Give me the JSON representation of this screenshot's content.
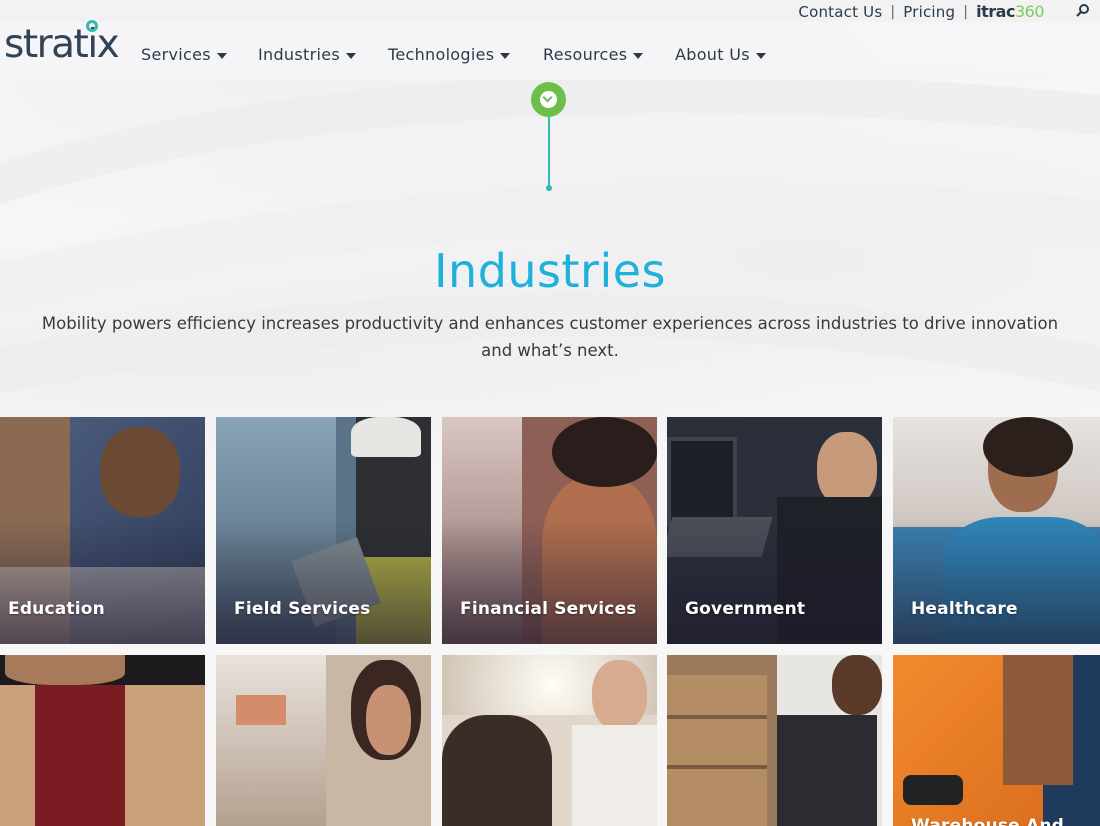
{
  "utility": {
    "contact": "Contact Us",
    "pricing": "Pricing",
    "sep": "|",
    "itrac_prefix": "itrac",
    "itrac_suffix": "360"
  },
  "brand": {
    "logo": "stratix"
  },
  "nav": {
    "items": [
      {
        "label": "Services"
      },
      {
        "label": "Industries"
      },
      {
        "label": "Technologies"
      },
      {
        "label": "Resources"
      },
      {
        "label": "About Us"
      }
    ]
  },
  "hero": {
    "title": "Industries",
    "subtitle": "Mobility powers efficiency increases productivity and enhances customer experiences across industries to drive innovation and what’s next."
  },
  "tiles": {
    "row1": [
      {
        "label": "Education",
        "color": "#8a6a52"
      },
      {
        "label": "Field Services",
        "color": "#5a7388"
      },
      {
        "label": "Financial Services",
        "color": "#8e5f55"
      },
      {
        "label": "Government",
        "color": "#2a2f3a"
      },
      {
        "label": "Healthcare",
        "color": "#3a7fae"
      }
    ],
    "row2": [
      {
        "label": "",
        "color": "#b5895e"
      },
      {
        "label": "",
        "color": "#c9b7a5"
      },
      {
        "label": "",
        "color": "#e0d6c9"
      },
      {
        "label": "",
        "color": "#9c7a5c"
      },
      {
        "label": "Warehouse And",
        "color": "#e87b2c"
      }
    ]
  }
}
